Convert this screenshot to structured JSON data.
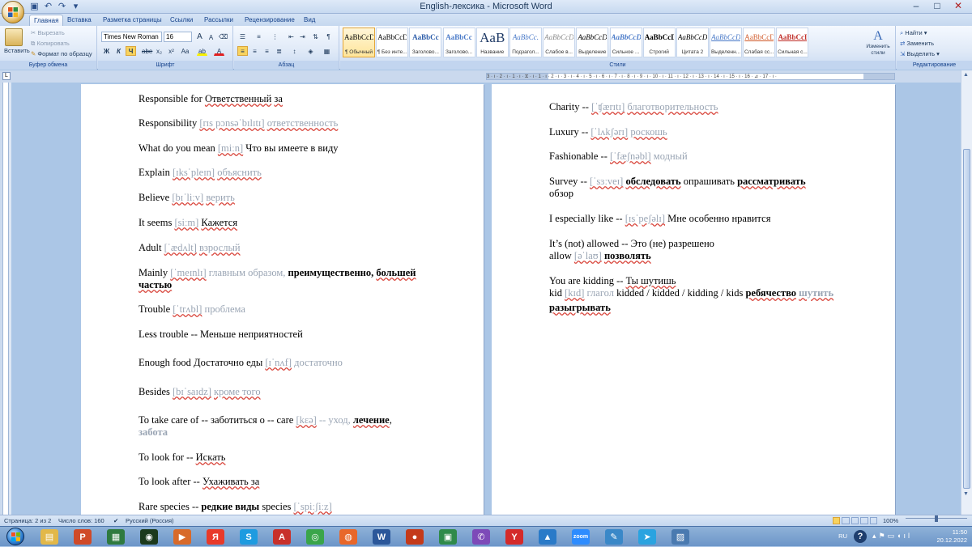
{
  "window": {
    "title": "English-лексика - Microsoft Word",
    "controls": {
      "minimize": "–",
      "maximize": "□",
      "close": "✕"
    }
  },
  "qat": {
    "save_icon": "save-icon",
    "undo_icon": "undo-icon",
    "redo_icon": "redo-icon"
  },
  "tabs": [
    "Главная",
    "Вставка",
    "Разметка страницы",
    "Ссылки",
    "Рассылки",
    "Рецензирование",
    "Вид"
  ],
  "active_tab": "Главная",
  "clipboard": {
    "paste": "Вставить",
    "cut": "Вырезать",
    "copy": "Копировать",
    "format_painter": "Формат по образцу",
    "label": "Буфер обмена"
  },
  "font": {
    "name": "Times New Roman",
    "size": "16",
    "label": "Шрифт",
    "bold": "Ж",
    "italic": "К",
    "underline": "Ч",
    "strike": "abe",
    "sub": "x₂",
    "sup": "x²",
    "case": "Aa",
    "grow": "A",
    "shrink": "A",
    "clear": "⌫",
    "highlight": "ab",
    "color": "A"
  },
  "paragraph": {
    "label": "Абзац",
    "pilcrow": "¶"
  },
  "styles": {
    "label": "Стили",
    "items": [
      {
        "preview": "AaBbCcDc",
        "name": "¶ Обычный",
        "selected": true
      },
      {
        "preview": "AaBbCcDc",
        "name": "¶ Без инте..."
      },
      {
        "preview": "AaBbCc",
        "name": "Заголово..."
      },
      {
        "preview": "AaBbCc",
        "name": "Заголово..."
      },
      {
        "preview": "AaB",
        "name": "Название"
      },
      {
        "preview": "AaBbCc.",
        "name": "Подзагол..."
      },
      {
        "preview": "AaBbCcDt",
        "name": "Слабое в..."
      },
      {
        "preview": "AaBbCcDt",
        "name": "Выделение"
      },
      {
        "preview": "AaBbCcDt",
        "name": "Сильное ..."
      },
      {
        "preview": "AaBbCcDc",
        "name": "Строгий"
      },
      {
        "preview": "AaBbCcDc",
        "name": "Цитата 2"
      },
      {
        "preview": "AaBbCcDt",
        "name": "Выделенн..."
      },
      {
        "preview": "AaBbCcDc",
        "name": "Слабая сс..."
      },
      {
        "preview": "AaBbCcDc",
        "name": "Сильная с..."
      }
    ],
    "change": "Изменить стили"
  },
  "editing": {
    "find": "Найти",
    "replace": "Заменить",
    "select": "Выделить",
    "label": "Редактирование"
  },
  "ruler": {
    "numbers": "3 · ı · 2 · ı · 1 · ı · ⧖ · ı · 1 · ı · 2 · ı · 3 · ı · 4 · ı · 5 · ı · 6 · ı · 7 · ı · 8 · ı · 9 · ı · 10 · ı · 11 · ı · 12 · ı · 13 · ı · 14 · ı · 15 · ı · 16 · ⊿ · 17 · ı ·"
  },
  "page1": [
    {
      "segs": [
        {
          "t": "Responsible for  "
        },
        {
          "t": "Ответственный",
          "c": "u"
        },
        {
          "t": "  "
        },
        {
          "t": "за",
          "c": "u"
        }
      ]
    },
    {
      "segs": [
        {
          "t": "Responsibility  "
        },
        {
          "t": "[rɪs pɔnsəˈbɪlɪtɪ]",
          "c": "ph u"
        },
        {
          "t": "  "
        },
        {
          "t": "ответственность",
          "c": "ph u"
        }
      ]
    },
    {
      "segs": [
        {
          "t": "What do you mean  "
        },
        {
          "t": "[miːn]",
          "c": "ph u"
        },
        {
          "t": "  Что вы имеете в виду"
        }
      ]
    },
    {
      "segs": [
        {
          "t": "Explain  "
        },
        {
          "t": "[ɪksˈpleɪn]",
          "c": "ph u"
        },
        {
          "t": "  "
        },
        {
          "t": "объяснить",
          "c": "ph u"
        }
      ]
    },
    {
      "segs": [
        {
          "t": "Believe  "
        },
        {
          "t": "[bɪˈliːv]",
          "c": "ph u"
        },
        {
          "t": "  "
        },
        {
          "t": "верить",
          "c": "ph u"
        }
      ]
    },
    {
      "segs": [
        {
          "t": "It seems  "
        },
        {
          "t": "[siːm]",
          "c": "ph u"
        },
        {
          "t": "  "
        },
        {
          "t": "Кажется",
          "c": "u"
        }
      ]
    },
    {
      "segs": [
        {
          "t": "Adult  "
        },
        {
          "t": "[ˈædʌlt]",
          "c": "ph u"
        },
        {
          "t": "  "
        },
        {
          "t": "взрослый",
          "c": "ph u"
        }
      ]
    },
    {
      "segs": [
        {
          "t": "Mainly  "
        },
        {
          "t": "[ˈmeɪnlɪ]",
          "c": "ph u"
        },
        {
          "t": "  главным образом,  ",
          "c": "ph"
        },
        {
          "t": "преимущественно,  ",
          "c": "b"
        },
        {
          "t": "большей",
          "c": "b u"
        }
      ]
    },
    {
      "segs": [
        {
          "t": "частью",
          "c": "b u"
        }
      ]
    },
    {
      "segs": [
        {
          "t": "Trouble  "
        },
        {
          "t": "[ˈtrʌbl]",
          "c": "ph u"
        },
        {
          "t": "   проблема",
          "c": "ph"
        }
      ]
    },
    {
      "segs": [
        {
          "t": "Less trouble --   Меньше неприятностей"
        }
      ]
    },
    {
      "segs": [
        {
          "t": "Enough food  Достаточно еды   "
        },
        {
          "t": "[ɪˈnʌf]",
          "c": "ph u"
        },
        {
          "t": "  достаточно",
          "c": "ph"
        }
      ]
    },
    {
      "segs": [
        {
          "t": "Besides   "
        },
        {
          "t": "[bɪˈsaɪdz]",
          "c": "ph u"
        },
        {
          "t": "  "
        },
        {
          "t": "кроме того",
          "c": "ph u"
        }
      ]
    },
    {
      "segs": [
        {
          "t": "To take care of --  заботиться  о   --   care "
        },
        {
          "t": "[kɛə]",
          "c": "ph u"
        },
        {
          "t": "  --  уход, ",
          "c": "ph"
        },
        {
          "t": "лечение",
          "c": "b u"
        },
        {
          "t": ","
        }
      ]
    },
    {
      "segs": [
        {
          "t": "забота",
          "c": "b ph"
        }
      ]
    },
    {
      "segs": [
        {
          "t": "To look for  --  "
        },
        {
          "t": "Искать",
          "c": "u"
        }
      ]
    },
    {
      "segs": [
        {
          "t": "To look after  --  "
        },
        {
          "t": "Ухаживать за",
          "c": "u"
        }
      ]
    },
    {
      "segs": [
        {
          "t": "Rare species --  "
        },
        {
          "t": "редкие виды",
          "c": "b"
        },
        {
          "t": "                 species  "
        },
        {
          "t": "[ˈspiːʃiːz]",
          "c": "ph u"
        }
      ]
    }
  ],
  "page2": [
    {
      "segs": [
        {
          "t": "Charity  --   "
        },
        {
          "t": "[ˈʧærɪtɪ]",
          "c": "ph u"
        },
        {
          "t": "  "
        },
        {
          "t": "благотворительность",
          "c": "ph u"
        }
      ]
    },
    {
      "segs": [
        {
          "t": "Luxury  --   "
        },
        {
          "t": "[ˈlʌkʃərɪ]",
          "c": "ph u"
        },
        {
          "t": "  "
        },
        {
          "t": "роскошь",
          "c": "ph u"
        }
      ]
    },
    {
      "segs": [
        {
          "t": "Fashionable  --    "
        },
        {
          "t": "[ˈfæʃnəbl]",
          "c": "ph u"
        },
        {
          "t": "  модный",
          "c": "ph"
        }
      ]
    },
    {
      "segs": [
        {
          "t": "Survey  --  "
        },
        {
          "t": "[ˈsɜːveɪ]",
          "c": "ph u"
        },
        {
          "t": "  "
        },
        {
          "t": "обследовать",
          "c": "b u"
        },
        {
          "t": "  опрашивать   "
        },
        {
          "t": "рассматривать",
          "c": "b u"
        }
      ]
    },
    {
      "segs": [
        {
          "t": "обзор"
        }
      ]
    },
    {
      "segs": [
        {
          "t": "I especially  like  --    "
        },
        {
          "t": "[ɪsˈpeʃəlɪ]",
          "c": "ph u"
        },
        {
          "t": "  Мне особенно нравится"
        }
      ]
    },
    {
      "segs": [
        {
          "t": "It’s (not) allowed   --  Это (не) разрешено"
        }
      ]
    },
    {
      "segs": [
        {
          "t": "allow "
        },
        {
          "t": "[əˈlaʊ]",
          "c": "ph u"
        },
        {
          "t": "  "
        },
        {
          "t": "позволять",
          "c": "b u"
        }
      ]
    },
    {
      "segs": [
        {
          "t": "You are kidding  --  "
        },
        {
          "t": "Ты шутишь",
          "c": "u"
        }
      ]
    },
    {
      "segs": [
        {
          "t": "kid "
        },
        {
          "t": "[kɪd]",
          "c": "ph u"
        },
        {
          "t": "  глагол   ",
          "c": "ph"
        },
        {
          "t": "kidded / kidded / kidding / kids  "
        },
        {
          "t": "ребячество",
          "c": "b u"
        },
        {
          "t": " "
        },
        {
          "t": "шутить",
          "c": "b ph u"
        }
      ]
    },
    {
      "segs": [
        {
          "t": "разыгрывать",
          "c": "b u"
        }
      ]
    }
  ],
  "status": {
    "page": "Страница: 2 из 2",
    "words": "Число слов: 160",
    "lang": "Русский (Россия)",
    "zoom": "100%"
  },
  "taskbar": {
    "lang": "RU",
    "time": "11:50",
    "date": "20.12.2022",
    "apps": [
      {
        "icon": "file-explorer-icon",
        "glyph": "▤",
        "color": "#e2b84a"
      },
      {
        "icon": "powerpoint-icon",
        "glyph": "P",
        "color": "#d04a28"
      },
      {
        "icon": "document-icon",
        "glyph": "▦",
        "color": "#2f7a3f"
      },
      {
        "icon": "eye-app-icon",
        "glyph": "◉",
        "color": "#1c3a1c"
      },
      {
        "icon": "media-player-icon",
        "glyph": "▶",
        "color": "#d86a2a"
      },
      {
        "icon": "yandex-browser-icon",
        "glyph": "Я",
        "color": "#e83a2a"
      },
      {
        "icon": "skype-icon",
        "glyph": "S",
        "color": "#1e9be0"
      },
      {
        "icon": "pdf-icon",
        "glyph": "A",
        "color": "#c8302a"
      },
      {
        "icon": "chrome-icon",
        "glyph": "◎",
        "color": "#3aa54a"
      },
      {
        "icon": "firefox-icon",
        "glyph": "◍",
        "color": "#e8672a"
      },
      {
        "icon": "word-icon",
        "glyph": "W",
        "color": "#2b579a"
      },
      {
        "icon": "media-icon",
        "glyph": "●",
        "color": "#c43a1a"
      },
      {
        "icon": "image-viewer-icon",
        "glyph": "▣",
        "color": "#2f8a4a"
      },
      {
        "icon": "viber-icon",
        "glyph": "✆",
        "color": "#7d4ab8"
      },
      {
        "icon": "yandex-icon",
        "glyph": "Y",
        "color": "#d42a2a"
      },
      {
        "icon": "photos-icon",
        "glyph": "▲",
        "color": "#2a7ac8"
      },
      {
        "icon": "zoom-icon",
        "glyph": "zoom",
        "color": "#2d8cff"
      },
      {
        "icon": "paint-icon",
        "glyph": "✎",
        "color": "#3a88c8"
      },
      {
        "icon": "telegram-icon",
        "glyph": "➤",
        "color": "#2aa3e0"
      },
      {
        "icon": "picture-icon",
        "glyph": "▨",
        "color": "#4a7ab0"
      }
    ]
  }
}
